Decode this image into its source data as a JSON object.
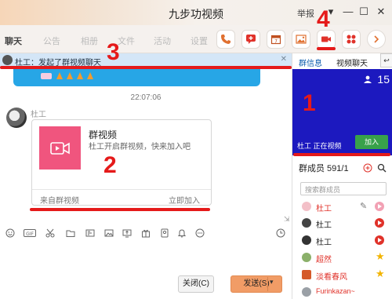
{
  "window": {
    "title": "九步功视频",
    "report": "举报"
  },
  "toolbar": {
    "tabs": [
      "聊天",
      "公告",
      "相册",
      "文件",
      "活动",
      "设置"
    ]
  },
  "notice": {
    "text": "杜工：发起了群视频聊天"
  },
  "chat": {
    "time": "22:07:06",
    "sender": "杜工",
    "card": {
      "title": "群视频",
      "desc": "杜工开启群视频，快来加入吧",
      "source": "来自群视频",
      "join": "立即加入"
    }
  },
  "input": {
    "close": "关闭(C)",
    "send": "发送(S)"
  },
  "right": {
    "tabs": [
      "群信息",
      "视频聊天"
    ],
    "video": {
      "count": "15",
      "status": "杜工 正在视频",
      "join": "加入"
    },
    "members_header": "群成员 591/1",
    "search_placeholder": "搜索群成员",
    "members": [
      {
        "name": "杜工",
        "color": "#e0322a"
      },
      {
        "name": "杜工",
        "color": "#222222"
      },
      {
        "name": "杜工",
        "color": "#222222"
      },
      {
        "name": "超然",
        "color": "#e0322a"
      },
      {
        "name": "淡看春风",
        "color": "#e0322a"
      },
      {
        "name": "Furinkazan~",
        "color": "#e0322a"
      }
    ]
  },
  "annotations": [
    "1",
    "2",
    "3",
    "4"
  ],
  "colors": {
    "accent": "#e51a1a",
    "video_bg": "#1c19bf",
    "card_thumb": "#f0557e",
    "notice_bg": "#d4e6f7"
  }
}
